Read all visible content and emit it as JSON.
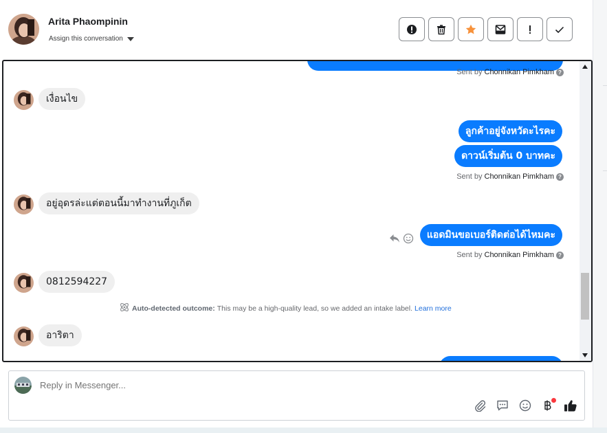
{
  "header": {
    "name": "Arita Phaompinin",
    "assign_label": "Assign this conversation",
    "actions": [
      "alert-circle-icon",
      "trash-icon",
      "star-icon",
      "mark-unread-icon",
      "exclamation-icon",
      "check-icon"
    ],
    "star_color": "#f7923b"
  },
  "thread": {
    "sent_by_prefix": "Sent by",
    "agent_name": "Chonnikan Pimkham",
    "messages": [
      {
        "dir": "in",
        "text": "เงื่อนไข"
      },
      {
        "dir": "out",
        "text": "ลูกค้าอยู่จังหวัดะไรคะ"
      },
      {
        "dir": "out",
        "text": "ดาวน์เริ่มต้น 0 บาทคะ"
      },
      {
        "dir": "in",
        "text": "อยู่อุดรล่ะแต่ตอนนี้มาทำงานที่ภูเก็ต"
      },
      {
        "dir": "out",
        "text": "แอดมินขอเบอร์ติดต่อได้ไหมคะ"
      },
      {
        "dir": "in",
        "text": "0812594227"
      },
      {
        "dir": "in",
        "text": "อาริตา"
      }
    ],
    "outcome": {
      "label": "Auto-detected outcome:",
      "text": "This may be a high-quality lead, so we added an intake label.",
      "link": "Learn more"
    }
  },
  "composer": {
    "placeholder": "Reply in Messenger...",
    "tools": [
      "paperclip-icon",
      "saved-reply-icon",
      "emoji-icon",
      "baht-payment-icon",
      "thumbs-up-icon"
    ]
  },
  "colors": {
    "outgoing_bubble": "#0a7cff",
    "incoming_bubble": "#efefef"
  }
}
